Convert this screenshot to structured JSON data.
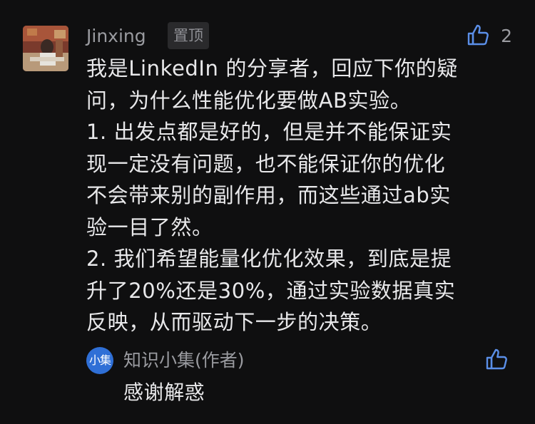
{
  "comment": {
    "author": "Jinxing",
    "badge": "置顶",
    "like_count": "2",
    "lines": [
      "我是LinkedIn 的分享者，回应下你的疑",
      "问，为什么性能优化要做AB实验。",
      "1. 出发点都是好的，但是并不能保证实",
      "现一定没有问题，也不能保证你的优化",
      "不会带来别的副作用，而这些通过ab实",
      "验一目了然。",
      "2. 我们希望能量化优化效果，到底是提",
      "升了20%还是30%，通过实验数据真实",
      "反映，从而驱动下一步的决策。"
    ]
  },
  "reply": {
    "avatar_text": "小集",
    "author": "知识小集(作者)",
    "text": "感谢解惑"
  },
  "icons": {
    "like": "thumbs-up-icon"
  }
}
